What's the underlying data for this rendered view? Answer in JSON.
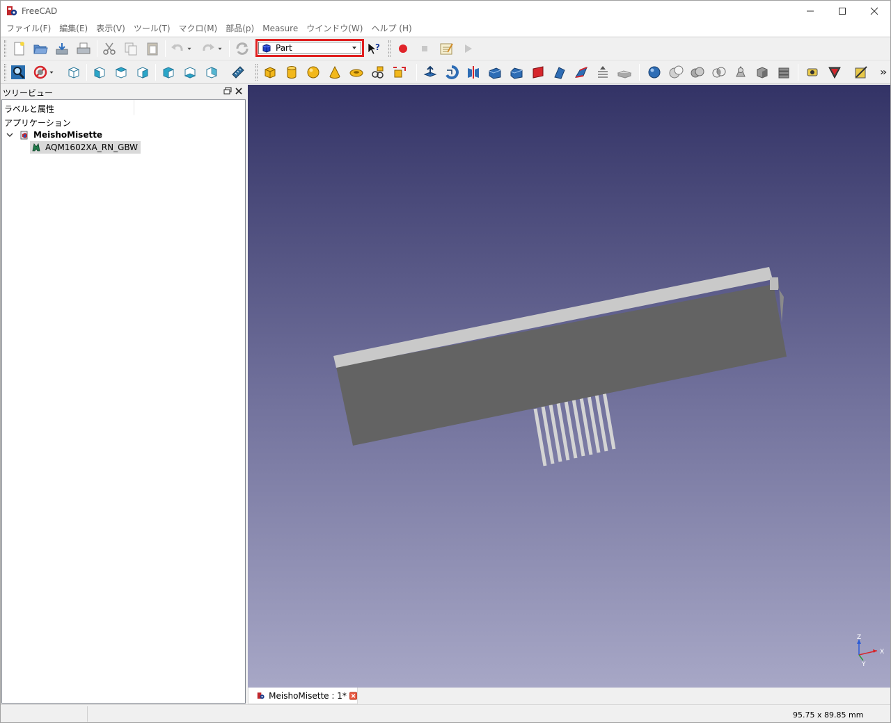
{
  "window": {
    "title": "FreeCAD"
  },
  "menu": {
    "items": [
      "ファイル(F)",
      "編集(E)",
      "表示(V)",
      "ツール(T)",
      "マクロ(M)",
      "部品(p)",
      "Measure",
      "ウインドウ(W)",
      "ヘルプ (H)"
    ]
  },
  "toolbar": {
    "workbench_selected": "Part"
  },
  "tree": {
    "panel_title": "ツリービュー",
    "column_header": "ラベルと属性",
    "group_label": "アプリケーション",
    "document_name": "MeishoMisette",
    "object_name": "AQM1602XA_RN_GBW"
  },
  "axis": {
    "x": "X",
    "y": "Y",
    "z": "Z"
  },
  "doc_tab": {
    "label": "MeishoMisette : 1*"
  },
  "status": {
    "dimensions": "95.75 x 89.85 mm"
  },
  "colors": {
    "accent_highlight": "#e02020",
    "view_top": "#333366",
    "view_bottom": "#a7a7c6",
    "model_body": "#636363",
    "model_top": "#c9c9c9"
  },
  "icons": {
    "toolbar1": [
      "new-file-icon",
      "open-file-icon",
      "save-icon",
      "print-icon",
      "cut-icon",
      "copy-icon",
      "paste-icon",
      "undo-icon",
      "redo-icon",
      "refresh-icon",
      "whats-this-icon",
      "record-macro-icon",
      "stop-macro-icon",
      "macros-icon",
      "run-macro-icon"
    ],
    "toolbar2": [
      "fit-all-icon",
      "draw-style-icon",
      "isometric-view-icon",
      "front-view-icon",
      "top-view-icon",
      "right-view-icon",
      "rear-view-icon",
      "bottom-view-icon",
      "left-view-icon",
      "measure-distance-icon",
      "box-icon",
      "cylinder-icon",
      "sphere-icon",
      "cone-icon",
      "torus-icon",
      "tube-icon",
      "primitives-icon",
      "shape-builder-icon",
      "extrude-icon",
      "revolve-icon",
      "mirror-icon",
      "fillet-icon",
      "chamfer-icon",
      "make-face-icon",
      "ruled-surface-icon",
      "loft-icon",
      "sweep-icon",
      "section-icon",
      "cross-sections-icon",
      "boolean-icon",
      "cut-shapes-icon",
      "fuse-icon",
      "common-icon",
      "compound-icon",
      "check-geometry-icon",
      "defeaturing-icon",
      "more-icon"
    ]
  }
}
